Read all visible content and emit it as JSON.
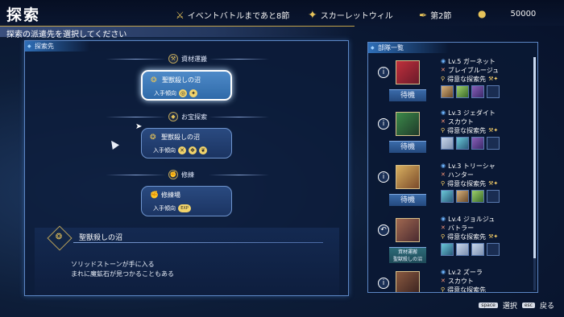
{
  "header": {
    "title": "探索",
    "event_text": "イベントバトルまであと8節",
    "chapter_name": "スカーレットウィル",
    "turn": "第2節",
    "gold": "50000"
  },
  "subtitle": "探索の派遣先を選択してください",
  "left_panel": {
    "tab_label": "探索先",
    "categories": [
      {
        "label": "資材運搬",
        "card": {
          "name": "聖獣殺しの沼",
          "yield_label": "入手傾向",
          "yield_icons": [
            "◎",
            "✦"
          ]
        }
      },
      {
        "label": "お宝探索",
        "card": {
          "name": "聖獣殺しの沼",
          "yield_label": "入手傾向",
          "yield_icons": [
            "✕",
            "❖",
            "❦"
          ]
        }
      },
      {
        "label": "修練",
        "card": {
          "name": "修練場",
          "yield_label": "入手傾向",
          "yield_icons": [
            "EXP"
          ]
        }
      }
    ],
    "detail": {
      "title": "聖獣殺しの沼",
      "line1": "ソリッドストーンが手に入る",
      "line2": "まれに魔鉱石が見つかることもある"
    }
  },
  "right_panel": {
    "tab_label": "部隊一覧",
    "members": [
      {
        "level": "Lv.5 ガーネット",
        "cls": "ブレイブルージュ",
        "pref": "得意な探索先",
        "state": "待機"
      },
      {
        "level": "Lv.3 ジェダイト",
        "cls": "スカウト",
        "pref": "得意な探索先",
        "state": "待機"
      },
      {
        "level": "Lv.3 トリーシャ",
        "cls": "ハンター",
        "pref": "得意な探索先",
        "state": "待機"
      },
      {
        "level": "Lv.4 ジョルジュ",
        "cls": "バトラー",
        "pref": "得意な探索先",
        "state_line1": "資材運搬",
        "state_line2": "聖獣殺しの沼"
      },
      {
        "level": "Lv.2 ズーラ",
        "cls": "スカウト",
        "pref": "得意な探索先"
      }
    ]
  },
  "footer": {
    "select_key": "space",
    "select_label": "選択",
    "back_key": "esc",
    "back_label": "戻る"
  }
}
